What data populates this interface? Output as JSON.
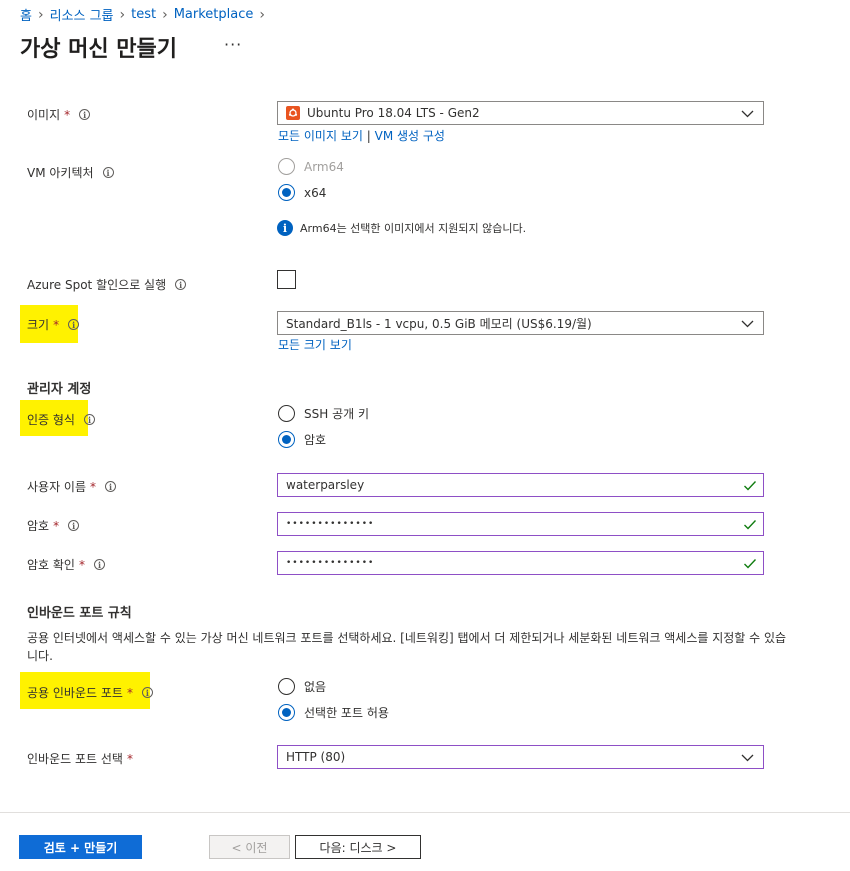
{
  "breadcrumb": [
    "홈",
    "리소스 그룹",
    "test",
    "Marketplace"
  ],
  "page_title": "가상 머신 만들기",
  "more_label": "···",
  "image": {
    "label": "이미지",
    "value": "Ubuntu Pro 18.04 LTS - Gen2",
    "link_all_images": "모든 이미지 보기",
    "link_separator": "|",
    "link_configure": "VM 생성 구성"
  },
  "architecture": {
    "label": "VM 아키텍처",
    "options": [
      "Arm64",
      "x64"
    ],
    "selected": "x64",
    "notice": "Arm64는 선택한 이미지에서 지원되지 않습니다."
  },
  "spot": {
    "label": "Azure Spot 할인으로 실행",
    "checked": false
  },
  "size": {
    "label": "크기",
    "value": "Standard_B1ls - 1 vcpu, 0.5 GiB 메모리 (US$6.19/월)",
    "link_all_sizes": "모든 크기 보기"
  },
  "admin": {
    "section_title": "관리자 계정",
    "auth_label": "인증 형식",
    "auth_options": [
      "SSH 공개 키",
      "암호"
    ],
    "auth_selected": "암호",
    "username_label": "사용자 이름",
    "username_value": "waterparsley",
    "password_label": "암호",
    "password_value": "••••••••••••••",
    "confirm_label": "암호 확인",
    "confirm_value": "••••••••••••••"
  },
  "inbound": {
    "section_title": "인바운드 포트 규칙",
    "description": "공용 인터넷에서 액세스할 수 있는 가상 머신 네트워크 포트를 선택하세요. [네트워킹] 탭에서 더 제한되거나 세분화된 네트워크 액세스를 지정할 수 있습니다.",
    "public_label": "공용 인바운드 포트",
    "public_options": [
      "없음",
      "선택한 포트 허용"
    ],
    "public_selected": "선택한 포트 허용",
    "select_label": "인바운드 포트 선택",
    "select_value": "HTTP (80)"
  },
  "required_mark": "*",
  "info_glyph": "i",
  "buttons": {
    "review_create": "검토 + 만들기",
    "previous": "< 이전",
    "next": "다음: 디스크 >"
  },
  "colors": {
    "link": "#0062c0",
    "primary": "#0f6cd6",
    "highlight": "#fff200",
    "required": "#a4262c",
    "valid_border": "#8e4fc6",
    "valid_check": "#107c10",
    "ubuntu": "#e95420"
  }
}
